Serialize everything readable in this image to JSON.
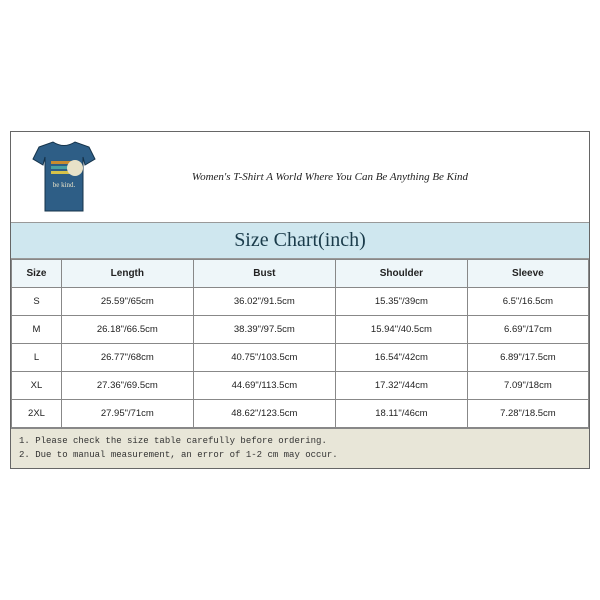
{
  "product": {
    "title": "Women's T-Shirt A World Where You Can Be Anything Be Kind",
    "shirt_text": "be kind."
  },
  "chart": {
    "title": "Size Chart(inch)",
    "headers": [
      "Size",
      "Length",
      "Bust",
      "Shoulder",
      "Sleeve"
    ],
    "rows": [
      {
        "size": "S",
        "length": "25.59\"/65cm",
        "bust": "36.02\"/91.5cm",
        "shoulder": "15.35\"/39cm",
        "sleeve": "6.5\"/16.5cm"
      },
      {
        "size": "M",
        "length": "26.18\"/66.5cm",
        "bust": "38.39\"/97.5cm",
        "shoulder": "15.94\"/40.5cm",
        "sleeve": "6.69\"/17cm"
      },
      {
        "size": "L",
        "length": "26.77\"/68cm",
        "bust": "40.75\"/103.5cm",
        "shoulder": "16.54\"/42cm",
        "sleeve": "6.89\"/17.5cm"
      },
      {
        "size": "XL",
        "length": "27.36\"/69.5cm",
        "bust": "44.69\"/113.5cm",
        "shoulder": "17.32\"/44cm",
        "sleeve": "7.09\"/18cm"
      },
      {
        "size": "2XL",
        "length": "27.95\"/71cm",
        "bust": "48.62\"/123.5cm",
        "shoulder": "18.11\"/46cm",
        "sleeve": "7.28\"/18.5cm"
      }
    ]
  },
  "notes": {
    "line1": "1. Please check the size table carefully before ordering.",
    "line2": "2. Due to manual measurement, an error of 1-2 cm may occur."
  }
}
